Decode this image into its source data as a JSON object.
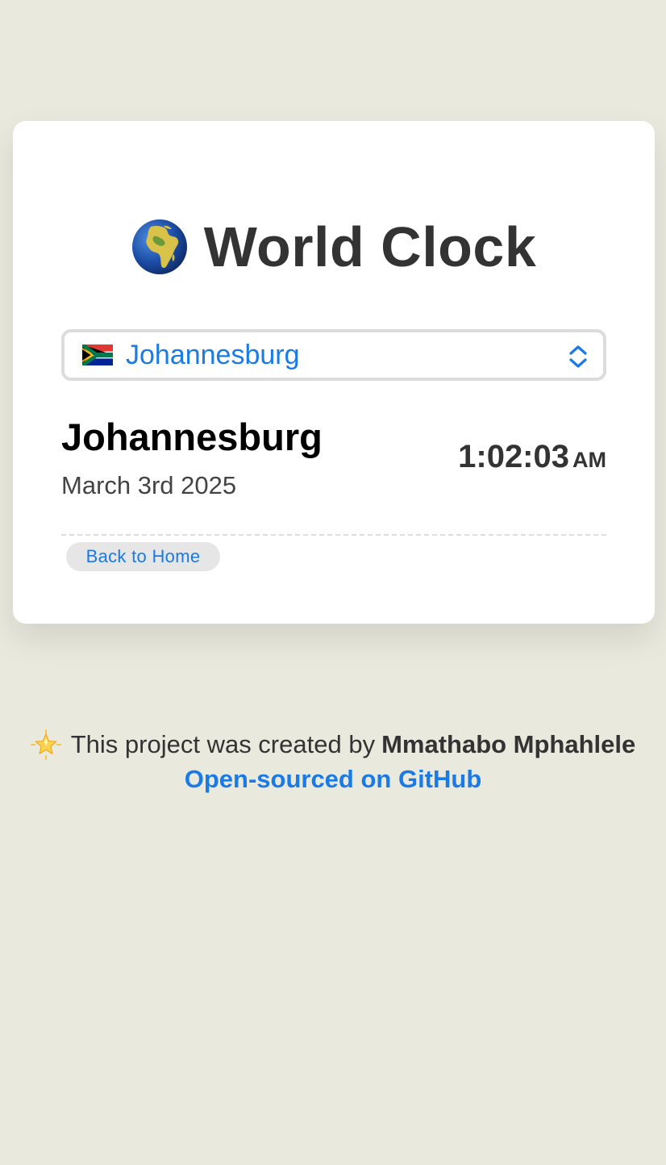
{
  "app": {
    "title": "World Clock",
    "globe_icon": "globe-africa-icon"
  },
  "city_select": {
    "flag_icon": "south-africa-flag-icon",
    "selected": "Johannesburg",
    "chevron_icon": "chevron-updown-icon"
  },
  "clock": {
    "city": "Johannesburg",
    "date": "March 3rd 2025",
    "time": "1:02:03",
    "ampm": "AM"
  },
  "nav": {
    "back_label": "Back to Home"
  },
  "footer": {
    "star_icon": "glowing-star-icon",
    "credit_text": "This project was created by",
    "author": "Mmathabo Mphahlele",
    "github_link": "Open-sourced on GitHub"
  },
  "colors": {
    "background": "#e9e9de",
    "accent": "#1a7ae6",
    "text_dark": "#333333"
  }
}
